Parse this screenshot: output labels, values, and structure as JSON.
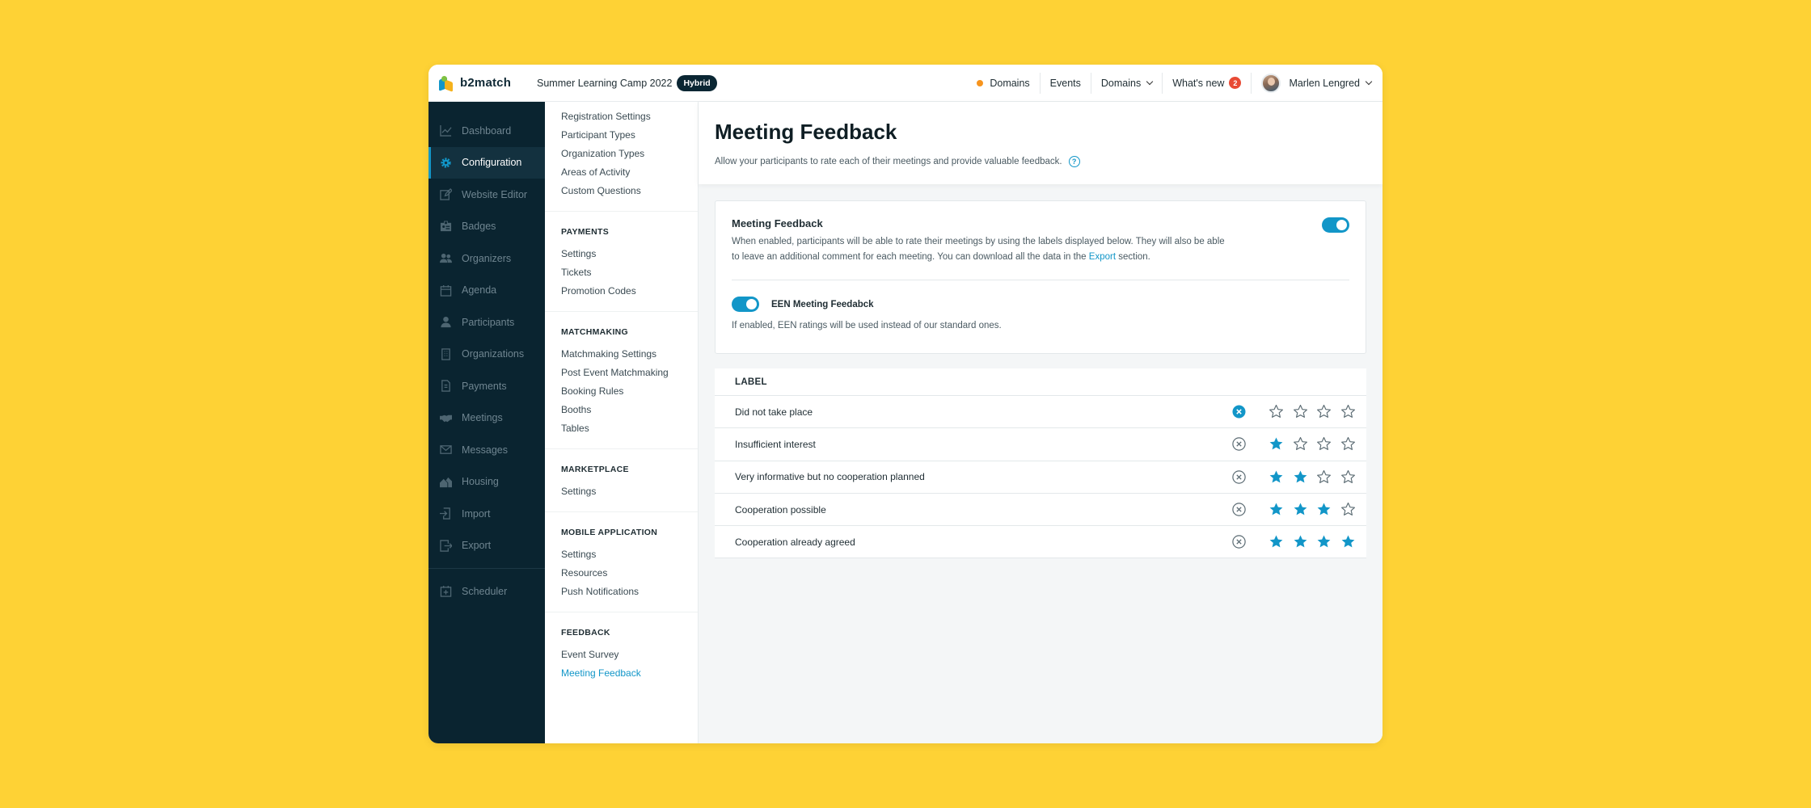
{
  "topbar": {
    "logo_text": "b2match",
    "event_title": "Summer Learning Camp 2022",
    "badge": "Hybrid",
    "items": [
      {
        "label": "Domains"
      },
      {
        "label": "Events"
      },
      {
        "label": "Domains"
      },
      {
        "label": "What's new",
        "count": "2"
      }
    ],
    "user_name": "Marlen Lengred"
  },
  "sidebar": {
    "items": [
      {
        "label": "Dashboard",
        "icon": "chart-icon"
      },
      {
        "label": "Configuration",
        "icon": "gear-icon",
        "active": true
      },
      {
        "label": "Website Editor",
        "icon": "edit-icon"
      },
      {
        "label": "Badges",
        "icon": "badge-icon"
      },
      {
        "label": "Organizers",
        "icon": "users-icon"
      },
      {
        "label": "Agenda",
        "icon": "calendar-icon"
      },
      {
        "label": "Participants",
        "icon": "person-icon"
      },
      {
        "label": "Organizations",
        "icon": "building-icon"
      },
      {
        "label": "Payments",
        "icon": "document-icon"
      },
      {
        "label": "Meetings",
        "icon": "handshake-icon"
      },
      {
        "label": "Messages",
        "icon": "mail-icon"
      },
      {
        "label": "Housing",
        "icon": "house-icon"
      },
      {
        "label": "Import",
        "icon": "import-icon"
      },
      {
        "label": "Export",
        "icon": "export-icon"
      },
      {
        "label": "Scheduler",
        "icon": "scheduler-icon"
      }
    ]
  },
  "submenu": {
    "top_items": [
      "Registration Settings",
      "Participant Types",
      "Organization Types",
      "Areas of Activity",
      "Custom Questions"
    ],
    "groups": [
      {
        "heading": "PAYMENTS",
        "items": [
          "Settings",
          "Tickets",
          "Promotion Codes"
        ]
      },
      {
        "heading": "MATCHMAKING",
        "items": [
          "Matchmaking Settings",
          "Post Event Matchmaking",
          "Booking Rules",
          "Booths",
          "Tables"
        ]
      },
      {
        "heading": "MARKETPLACE",
        "items": [
          "Settings"
        ]
      },
      {
        "heading": "MOBILE APPLICATION",
        "items": [
          "Settings",
          "Resources",
          "Push Notifications"
        ]
      },
      {
        "heading": "FEEDBACK",
        "items": [
          "Event Survey",
          "Meeting Feedback"
        ]
      }
    ],
    "active_item": "Meeting Feedback"
  },
  "main": {
    "title": "Meeting Feedback",
    "description": "Allow your participants to rate each of their meetings and provide valuable feedback.",
    "card": {
      "title": "Meeting Feedback",
      "text_before_link": "When enabled, participants will be able to rate their meetings by using the labels displayed below. They will also be able to leave an additional comment for each meeting. You can download all the data in the ",
      "link": "Export",
      "text_after_link": " section.",
      "enabled": true,
      "een_label": "EEN Meeting Feedabck",
      "een_enabled": true,
      "een_desc": "If enabled, EEN ratings will be used instead of our standard ones."
    },
    "table": {
      "header": "LABEL",
      "max_stars": 4,
      "rows": [
        {
          "label": "Did not take place",
          "stars": 0
        },
        {
          "label": "Insufficient interest",
          "stars": 1
        },
        {
          "label": "Very informative but no cooperation planned",
          "stars": 2
        },
        {
          "label": "Cooperation possible",
          "stars": 3
        },
        {
          "label": "Cooperation already agreed",
          "stars": 4
        }
      ]
    }
  },
  "colors": {
    "accent": "#1296C8",
    "sidebar_bg": "#0A2430",
    "page_bg": "#FED235",
    "notify": "#E84A34",
    "status_dot": "#F7941D"
  }
}
